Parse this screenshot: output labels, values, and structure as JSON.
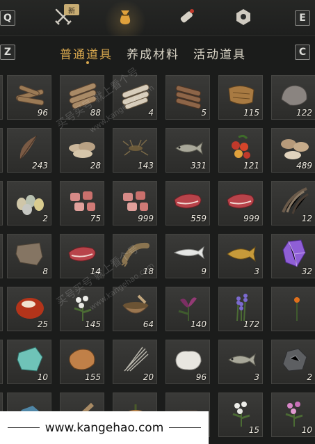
{
  "keys": {
    "left_top": "Q",
    "right_top": "E",
    "left_sub": "Z",
    "right_sub": "C"
  },
  "categories": [
    {
      "icon": "crossed-swords-icon",
      "badge": "新"
    },
    {
      "icon": "pouch-icon"
    },
    {
      "icon": "scroll-icon"
    },
    {
      "icon": "gem-icon"
    }
  ],
  "subtabs": [
    {
      "label": "普通道具",
      "active": true
    },
    {
      "label": "养成材料",
      "active": false
    },
    {
      "label": "活动道具",
      "active": false
    }
  ],
  "colors": {
    "accent": "#d9a84e",
    "background": "#1b1c1b",
    "slot": "#353533"
  },
  "items": [
    {
      "icon": "firewood-icon",
      "count": "96"
    },
    {
      "icon": "logs-icon",
      "count": "88"
    },
    {
      "icon": "birch-logs-icon",
      "count": "4"
    },
    {
      "icon": "timber-icon",
      "count": "5"
    },
    {
      "icon": "bark-icon",
      "count": "115"
    },
    {
      "icon": "stone-icon",
      "count": "122"
    },
    {
      "icon": "feather-icon",
      "count": "243"
    },
    {
      "icon": "mushrooms-icon",
      "count": "28"
    },
    {
      "icon": "insect-icon",
      "count": "143"
    },
    {
      "icon": "fish-icon",
      "count": "331"
    },
    {
      "icon": "berries-icon",
      "count": "121"
    },
    {
      "icon": "shiitake-icon",
      "count": "489"
    },
    {
      "icon": "eggs-icon",
      "count": "2"
    },
    {
      "icon": "meat-chunks-icon",
      "count": "75"
    },
    {
      "icon": "meat-chunks-icon",
      "count": "999"
    },
    {
      "icon": "steak-icon",
      "count": "559"
    },
    {
      "icon": "steak-icon",
      "count": "999"
    },
    {
      "icon": "quills-icon",
      "count": "12"
    },
    {
      "icon": "hide-icon",
      "count": "8"
    },
    {
      "icon": "steak-icon",
      "count": "14"
    },
    {
      "icon": "shrimp-icon",
      "count": "18"
    },
    {
      "icon": "silver-fish-icon",
      "count": "9"
    },
    {
      "icon": "carp-icon",
      "count": "3"
    },
    {
      "icon": "amethyst-icon",
      "count": "32"
    },
    {
      "icon": "red-stone-icon",
      "count": "25"
    },
    {
      "icon": "white-flower-icon",
      "count": "145"
    },
    {
      "icon": "herb-bowl-icon",
      "count": "64"
    },
    {
      "icon": "purple-lily-icon",
      "count": "140"
    },
    {
      "icon": "lavender-icon",
      "count": "172"
    },
    {
      "icon": "orange-flower-icon",
      "count": ""
    },
    {
      "icon": "jade-icon",
      "count": "10"
    },
    {
      "icon": "pelt-icon",
      "count": "155"
    },
    {
      "icon": "straw-icon",
      "count": "20"
    },
    {
      "icon": "wool-icon",
      "count": "96"
    },
    {
      "icon": "fish-icon",
      "count": "3"
    },
    {
      "icon": "ore-icon",
      "count": "2"
    },
    {
      "icon": "blue-ore-icon",
      "count": ""
    },
    {
      "icon": "bundle-icon",
      "count": ""
    },
    {
      "icon": "pumpkin-icon",
      "count": ""
    },
    {
      "icon": "dark-item-icon",
      "count": ""
    },
    {
      "icon": "white-flower-icon",
      "count": "15"
    },
    {
      "icon": "pink-flower-icon",
      "count": "10"
    }
  ],
  "watermark": {
    "lines": [
      "买号买号 就上看个号",
      "www.kangehao.com",
      "买号买号 就上看个号",
      "www.kangehao.com"
    ],
    "banner": "www.kangehao.com"
  }
}
